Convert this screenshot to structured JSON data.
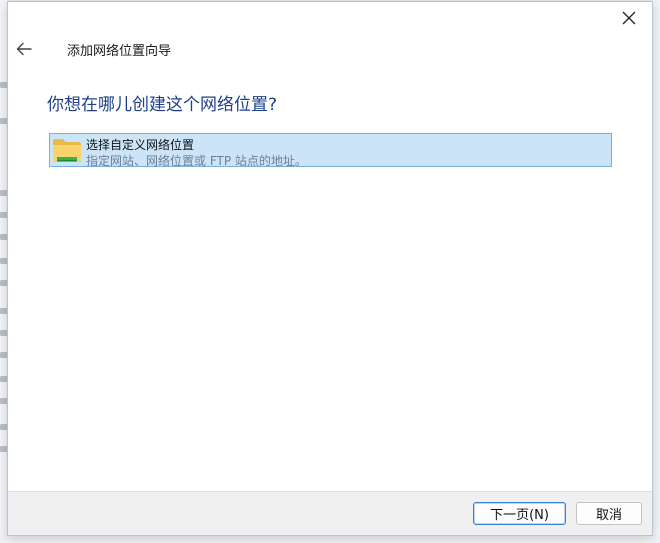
{
  "dialog": {
    "close_icon": "close-icon",
    "back_icon": "back-arrow-icon",
    "wizard_title": "添加网络位置向导",
    "question": "你想在哪儿创建这个网络位置?",
    "option": {
      "icon": "folder-icon",
      "title": "选择自定义网络位置",
      "description": "指定网站、网络位置或 FTP 站点的地址。"
    },
    "buttons": {
      "next": "下一页(N)",
      "cancel": "取消"
    }
  },
  "colors": {
    "question_text": "#1f3f8a",
    "option_selected_bg": "#cce4f7",
    "option_selected_border": "#7aaede",
    "primary_button_border": "#3c7fd3"
  }
}
